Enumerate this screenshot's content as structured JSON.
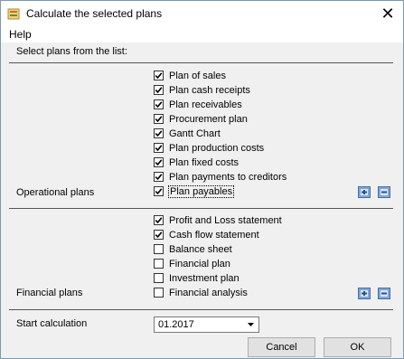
{
  "window": {
    "title": "Calculate the selected plans",
    "close": "✕"
  },
  "menu": {
    "help": "Help"
  },
  "intro": "Select plans from the list:",
  "operational": {
    "label": "Operational plans",
    "items": [
      {
        "label": "Plan of sales",
        "checked": true
      },
      {
        "label": "Plan cash receipts",
        "checked": true
      },
      {
        "label": "Plan receivables",
        "checked": true
      },
      {
        "label": "Procurement plan",
        "checked": true
      },
      {
        "label": "Gantt Chart",
        "checked": true
      },
      {
        "label": "Plan production costs",
        "checked": true
      },
      {
        "label": "Plan fixed costs",
        "checked": true
      },
      {
        "label": "Plan payments to creditors",
        "checked": true
      },
      {
        "label": "Plan payables",
        "checked": true
      }
    ]
  },
  "financial": {
    "label": "Financial plans",
    "items": [
      {
        "label": "Profit and Loss statement",
        "checked": true
      },
      {
        "label": "Cash flow statement",
        "checked": true
      },
      {
        "label": "Balance sheet",
        "checked": false
      },
      {
        "label": "Financial plan",
        "checked": false
      },
      {
        "label": "Investment plan",
        "checked": false
      },
      {
        "label": "Financial analysis",
        "checked": false
      }
    ]
  },
  "start": {
    "label": "Start calculation",
    "value": "01.2017"
  },
  "buttons": {
    "cancel": "Cancel",
    "ok": "OK"
  }
}
